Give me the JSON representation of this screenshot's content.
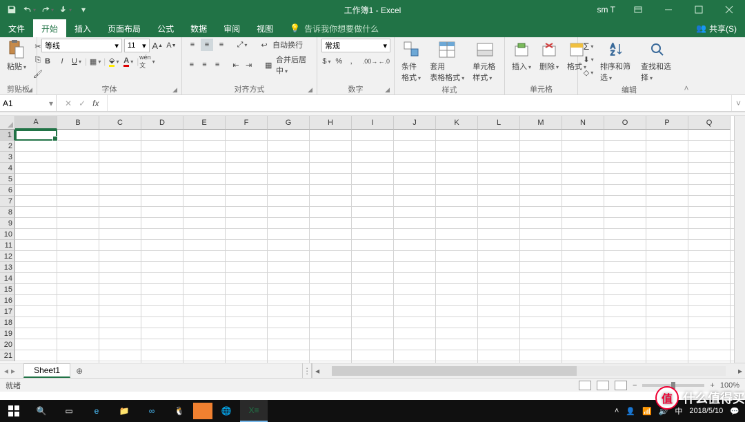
{
  "title": "工作簿1  -  Excel",
  "user": "sm T",
  "tabs": {
    "file": "文件",
    "home": "开始",
    "insert": "插入",
    "pagelayout": "页面布局",
    "formulas": "公式",
    "data": "数据",
    "review": "审阅",
    "view": "视图",
    "tell": "告诉我你想要做什么"
  },
  "share": "共享(S)",
  "ribbon": {
    "clipboard": {
      "paste": "粘贴",
      "label": "剪贴板"
    },
    "font": {
      "name": "等线",
      "size": "11",
      "label": "字体"
    },
    "align": {
      "wrap": "自动换行",
      "merge": "合并后居中",
      "label": "对齐方式"
    },
    "number": {
      "format": "常规",
      "label": "数字"
    },
    "styles": {
      "cond": "条件格式",
      "table": "套用\n表格格式",
      "cell": "单元格样式",
      "label": "样式"
    },
    "cells": {
      "insert": "插入",
      "delete": "删除",
      "format": "格式",
      "label": "单元格"
    },
    "editing": {
      "sort": "排序和筛选",
      "find": "查找和选择",
      "label": "编辑"
    }
  },
  "namebox": "A1",
  "columns": [
    "A",
    "B",
    "C",
    "D",
    "E",
    "F",
    "G",
    "H",
    "I",
    "J",
    "K",
    "L",
    "M",
    "N",
    "O",
    "P",
    "Q"
  ],
  "rows": [
    "1",
    "2",
    "3",
    "4",
    "5",
    "6",
    "7",
    "8",
    "9",
    "10",
    "11",
    "12",
    "13",
    "14",
    "15",
    "16",
    "17",
    "18",
    "19",
    "20",
    "21"
  ],
  "sheet": "Sheet1",
  "status": "就绪",
  "zoom": "100%",
  "clock": "2018/5/10",
  "watermark": "什么值得买"
}
